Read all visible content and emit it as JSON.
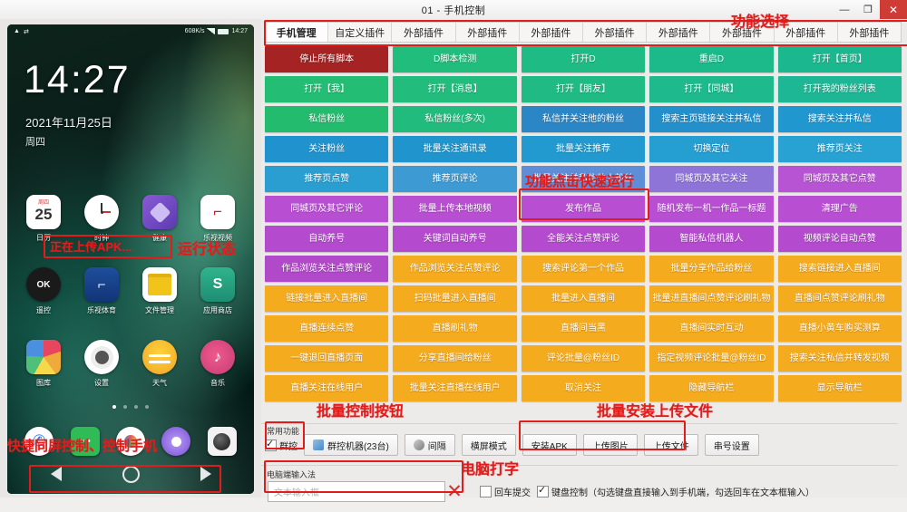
{
  "window": {
    "title": "01 - 手机控制",
    "minimize": "—",
    "maximize": "❐",
    "close": "✕"
  },
  "phone": {
    "status_left_icons": [
      "warning-icon",
      "usb-icon"
    ],
    "net_speed": "608K/s",
    "status_time": "14:27",
    "clock": "14:27",
    "date": "2021年11月25日",
    "weekday": "周四",
    "apps_row1": [
      {
        "label": "日历",
        "icon": "calendar-icon",
        "cal_top": "周四",
        "cal_num": "25"
      },
      {
        "label": "时钟",
        "icon": "clock-icon"
      },
      {
        "label": "健康",
        "icon": "health-icon"
      },
      {
        "label": "乐视视频",
        "icon": "letv-video-icon"
      }
    ],
    "apps_row2": [
      {
        "label": "遥控",
        "icon": "remote-ok-icon"
      },
      {
        "label": "乐视体育",
        "icon": "letv-sports-icon"
      },
      {
        "label": "文件管理",
        "icon": "file-manager-icon"
      },
      {
        "label": "应用商店",
        "icon": "app-store-icon"
      }
    ],
    "apps_row3": [
      {
        "label": "图库",
        "icon": "gallery-icon"
      },
      {
        "label": "设置",
        "icon": "settings-icon"
      },
      {
        "label": "天气",
        "icon": "weather-icon"
      },
      {
        "label": "音乐",
        "icon": "music-icon"
      }
    ],
    "dock": [
      {
        "icon": "phone-dial-icon"
      },
      {
        "icon": "messages-icon"
      },
      {
        "icon": "browser-icon"
      },
      {
        "icon": "assistant-icon"
      },
      {
        "icon": "camera-icon"
      }
    ],
    "upload_status": "正在上传APK...",
    "nav": {
      "back": "back-triangle-icon",
      "home": "home-circle-icon",
      "recent": "recent-triangle-icon"
    },
    "page_dots": 4,
    "active_dot": 0
  },
  "annotations": [
    {
      "name": "function-select",
      "text": "功能选择"
    },
    {
      "name": "run-status",
      "text": "运行状态"
    },
    {
      "name": "quick-run",
      "text": "功能点击快速运行"
    },
    {
      "name": "batch-control-buttons",
      "text": "批量控制按钮"
    },
    {
      "name": "batch-install-upload",
      "text": "批量安装上传文件"
    },
    {
      "name": "pc-typing",
      "text": "电脑打字"
    },
    {
      "name": "screen-mirror-control",
      "text": "快捷同屏控制、控制手机"
    }
  ],
  "tabs": [
    {
      "label": "手机管理",
      "active": true
    },
    {
      "label": "自定义插件",
      "active": false
    },
    {
      "label": "外部插件",
      "active": false
    },
    {
      "label": "外部插件",
      "active": false
    },
    {
      "label": "外部插件",
      "active": false
    },
    {
      "label": "外部插件",
      "active": false
    },
    {
      "label": "外部插件",
      "active": false
    },
    {
      "label": "外部插件",
      "active": false
    },
    {
      "label": "外部插件",
      "active": false
    },
    {
      "label": "外部插件",
      "active": false
    }
  ],
  "colors": {
    "danger_red": "#a52323",
    "green": "#18b26a",
    "green_teal": "#1fb98b",
    "blue": "#1f93cc",
    "blue_purple": "#6f6fd0",
    "purple": "#b348cc",
    "magenta": "#c24bd4",
    "orange": "#f5a81c",
    "highlight_red": "#e21b1b"
  },
  "buttons": [
    {
      "label": "停止所有脚本",
      "color": "#a52323"
    },
    {
      "label": "D脚本检测",
      "color": "#21bd7c"
    },
    {
      "label": "打开D",
      "color": "#1fbb84"
    },
    {
      "label": "重启D",
      "color": "#1cb98b"
    },
    {
      "label": "打开【首页】",
      "color": "#1bb78f"
    },
    {
      "label": "打开【我】",
      "color": "#24bd74"
    },
    {
      "label": "打开【消息】",
      "color": "#22bc7c"
    },
    {
      "label": "打开【朋友】",
      "color": "#20ba85"
    },
    {
      "label": "打开【同城】",
      "color": "#1eb98d"
    },
    {
      "label": "打开我的粉丝列表",
      "color": "#1db795"
    },
    {
      "label": "私信粉丝",
      "color": "#23bb6d"
    },
    {
      "label": "私信粉丝(多次)",
      "color": "#22bb7e"
    },
    {
      "label": "私信并关注他的粉丝",
      "color": "#2b86c6"
    },
    {
      "label": "搜索主页链接关注并私信",
      "color": "#2390cc"
    },
    {
      "label": "搜索关注并私信",
      "color": "#2097cf"
    },
    {
      "label": "关注粉丝",
      "color": "#2092cd"
    },
    {
      "label": "批量关注通讯录",
      "color": "#2095cd"
    },
    {
      "label": "批量关注推荐",
      "color": "#2299cf"
    },
    {
      "label": "切换定位",
      "color": "#259ed1"
    },
    {
      "label": "推荐页关注",
      "color": "#27a2d3"
    },
    {
      "label": "推荐页点赞",
      "color": "#2a9ed0"
    },
    {
      "label": "推荐页评论",
      "color": "#3e9ad2"
    },
    {
      "label": "批量关注并私信他人粉丝",
      "color": "#5e8ed8"
    },
    {
      "label": "同城页及其它关注",
      "color": "#8f74d8"
    },
    {
      "label": "同城页及其它点赞",
      "color": "#b654d4"
    },
    {
      "label": "同城页及其它评论",
      "color": "#b84fd2"
    },
    {
      "label": "批量上传本地视频",
      "color": "#b84fd2"
    },
    {
      "label": "发布作品",
      "color": "#b84fd2",
      "highlight": true
    },
    {
      "label": "随机发布一机一作品一标题",
      "color": "#b84fd2"
    },
    {
      "label": "清理广告",
      "color": "#b84fd2"
    },
    {
      "label": "自动养号",
      "color": "#b44ace"
    },
    {
      "label": "关键词自动养号",
      "color": "#b44ace"
    },
    {
      "label": "全能关注点赞评论",
      "color": "#b44ace"
    },
    {
      "label": "智能私信机器人",
      "color": "#b44ace"
    },
    {
      "label": "视频评论自动点赞",
      "color": "#b44ace"
    },
    {
      "label": "作品浏览关注点赞评论",
      "color": "#b04ac8"
    },
    {
      "label": "作品浏览关注点赞评论",
      "color": "#f5ab1e"
    },
    {
      "label": "搜索评论第一个作品",
      "color": "#f5ab1e"
    },
    {
      "label": "批量分享作品给粉丝",
      "color": "#f5ab1e"
    },
    {
      "label": "搜索链接进入直播间",
      "color": "#f5ab1e"
    },
    {
      "label": "链接批量进入直播间",
      "color": "#f5ab1e"
    },
    {
      "label": "扫码批量进入直播间",
      "color": "#f5ab1e"
    },
    {
      "label": "批量进入直播间",
      "color": "#f5ab1e"
    },
    {
      "label": "批量进直播间点赞评论刷礼物",
      "color": "#f5ab1e"
    },
    {
      "label": "直播间点赞评论刷礼物",
      "color": "#f5ab1e"
    },
    {
      "label": "直播连续点赞",
      "color": "#f5ab1e"
    },
    {
      "label": "直播刷礼物",
      "color": "#f5ab1e"
    },
    {
      "label": "直播间当黑",
      "color": "#f5ab1e"
    },
    {
      "label": "直播间实时互动",
      "color": "#f5ab1e"
    },
    {
      "label": "直播小黄车购买测算",
      "color": "#f5ab1e"
    },
    {
      "label": "一键退回直播页面",
      "color": "#f5ab1e"
    },
    {
      "label": "分享直播间给粉丝",
      "color": "#f5ab1e"
    },
    {
      "label": "评论批量@粉丝ID",
      "color": "#f5ab1e"
    },
    {
      "label": "指定视频评论批量@粉丝ID",
      "color": "#f5ab1e"
    },
    {
      "label": "搜索关注私信并转发视频",
      "color": "#f5ab1e"
    },
    {
      "label": "直播关注在线用户",
      "color": "#f5ab1e"
    },
    {
      "label": "批量关注直播在线用户",
      "color": "#f5ab1e"
    },
    {
      "label": "取消关注",
      "color": "#f5ab1e"
    },
    {
      "label": "隐藏导航栏",
      "color": "#f5ab1e"
    },
    {
      "label": "显示导航栏",
      "color": "#f5ab1e"
    }
  ],
  "toolbar": {
    "section_label": "常用功能",
    "group_checkbox_label": "群控",
    "group_checkbox_checked": true,
    "machines_button": "群控机器(23台)",
    "interval_button": "间隔",
    "landscape_button": "横屏模式",
    "install_apk_button": "安装APK",
    "upload_image_button": "上传图片",
    "upload_file_button": "上传文件",
    "serial_settings_button": "串号设置"
  },
  "input_section": {
    "section_label": "电脑端输入法",
    "placeholder": "文本输入框",
    "value": "",
    "clear_icon": "clear-x-icon",
    "enter_submit_label": "回车提交",
    "enter_submit_checked": false,
    "keyboard_control_label": "键盘控制（勾选键盘直接输入到手机端，勾选回车在文本框输入）",
    "keyboard_control_checked": true
  }
}
